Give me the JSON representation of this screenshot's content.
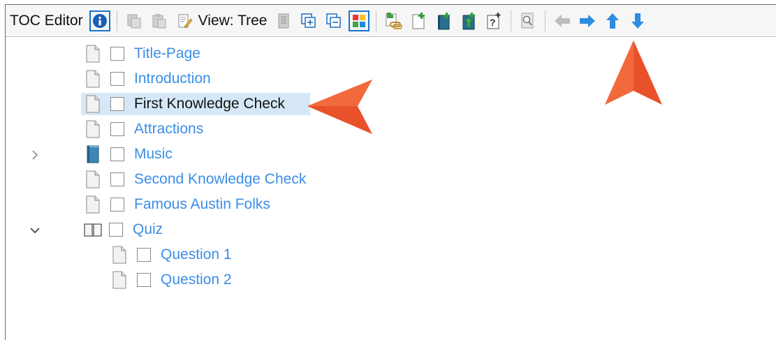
{
  "toolbar": {
    "title": "TOC Editor",
    "view_label": "View: Tree",
    "icons": [
      "info-icon",
      "copy-icon",
      "paste-icon",
      "notepad-icon",
      "properties-icon",
      "expand-all-icon",
      "collapse-all-icon",
      "tiles-icon",
      "link-icon",
      "new-page-icon",
      "new-book-icon",
      "new-chapter-icon",
      "new-question-icon",
      "search-icon",
      "arrow-left-icon",
      "arrow-right-icon",
      "arrow-up-icon",
      "arrow-down-icon"
    ],
    "accent": "#1a73c9"
  },
  "tree": {
    "items": [
      {
        "label": "Title-Page",
        "type": "page",
        "expander": "",
        "level": 0
      },
      {
        "label": "Introduction",
        "type": "page",
        "expander": "",
        "level": 0
      },
      {
        "label": "First Knowledge Check",
        "type": "page",
        "expander": "",
        "level": 0,
        "selected": true
      },
      {
        "label": "Attractions",
        "type": "page",
        "expander": "",
        "level": 0
      },
      {
        "label": "Music",
        "type": "book-closed",
        "expander": "collapsed",
        "level": 0
      },
      {
        "label": "Second Knowledge Check",
        "type": "page",
        "expander": "",
        "level": 0
      },
      {
        "label": "Famous Austin Folks",
        "type": "page",
        "expander": "",
        "level": 0
      },
      {
        "label": "Quiz",
        "type": "book-open",
        "expander": "expanded",
        "level": 0
      },
      {
        "label": "Question 1",
        "type": "page",
        "expander": "",
        "level": 1
      },
      {
        "label": "Question 2",
        "type": "page",
        "expander": "",
        "level": 1
      }
    ],
    "link_color": "#3a8ee6",
    "selection_color": "#d6e8f7"
  },
  "annotations": {
    "arrow_color": "#e8512a"
  }
}
